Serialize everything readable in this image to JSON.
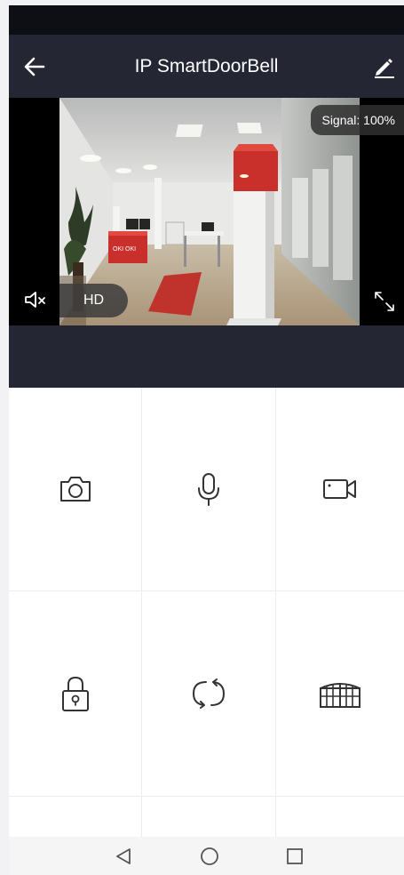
{
  "header": {
    "title": "IP SmartDoorBell"
  },
  "video": {
    "signal_label": "Signal: 100%",
    "quality_label": "HD",
    "scene_text": "OKI OKI"
  },
  "controls": [
    {
      "name": "snapshot",
      "icon": "camera-icon"
    },
    {
      "name": "talk",
      "icon": "microphone-icon"
    },
    {
      "name": "record",
      "icon": "video-camera-icon"
    },
    {
      "name": "unlock",
      "icon": "padlock-icon"
    },
    {
      "name": "rotate",
      "icon": "rotate-icon"
    },
    {
      "name": "gate",
      "icon": "gate-icon"
    }
  ],
  "nav": {
    "icons": [
      "back-triangle-icon",
      "home-circle-icon",
      "recents-square-icon"
    ]
  },
  "colors": {
    "header_bg": "#242733",
    "status_bar_bg": "#0e0f15",
    "icon_stroke": "#333333",
    "accent_red": "#c9302c"
  }
}
